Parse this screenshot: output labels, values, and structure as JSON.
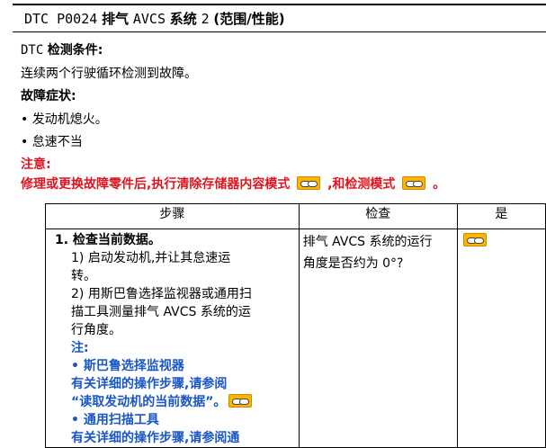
{
  "title": {
    "code": "DTC P0024",
    "name": "排气",
    "system": "AVCS",
    "word": "系统",
    "num": "2",
    "range": "(范围/性能)"
  },
  "condition": {
    "label_prefix": "DTC",
    "label_suffix": "检测条件:",
    "text": "连续两个行驶循环检测到故障。"
  },
  "symptoms": {
    "label": "故障症状:",
    "items": [
      "• 发动机熄火。",
      "• 怠速不当"
    ]
  },
  "caution": {
    "label": "注意:",
    "text_part1": "修理或更换故障零件后,执行清除存储器内容模式",
    "text_part2": ",和检测模式",
    "text_end": "。"
  },
  "table": {
    "headers": [
      "步骤",
      "检查",
      "是"
    ],
    "step": {
      "title": "1. 检查当前数据。",
      "lines": [
        "1) 启动发动机,并让其怠速运",
        "转。",
        "2) 用斯巴鲁选择监视器或通用扫",
        "描工具测量排气 AVCS 系统的运",
        "行角度。"
      ],
      "note_label": "注:",
      "note_item1": "• 斯巴鲁选择监视器",
      "note_item1_text1": "有关详细的操作步骤,请参阅",
      "note_item1_text2": "“读取发动机的当前数据”。",
      "note_item2": "• 通用扫描工具",
      "note_item2_text1": "有关详细的操作步骤,请参阅通"
    },
    "check": [
      "排气 AVCS 系统的运行",
      "角度是否约为 0°?"
    ]
  },
  "icons": {
    "link": "link-reference-icon"
  }
}
